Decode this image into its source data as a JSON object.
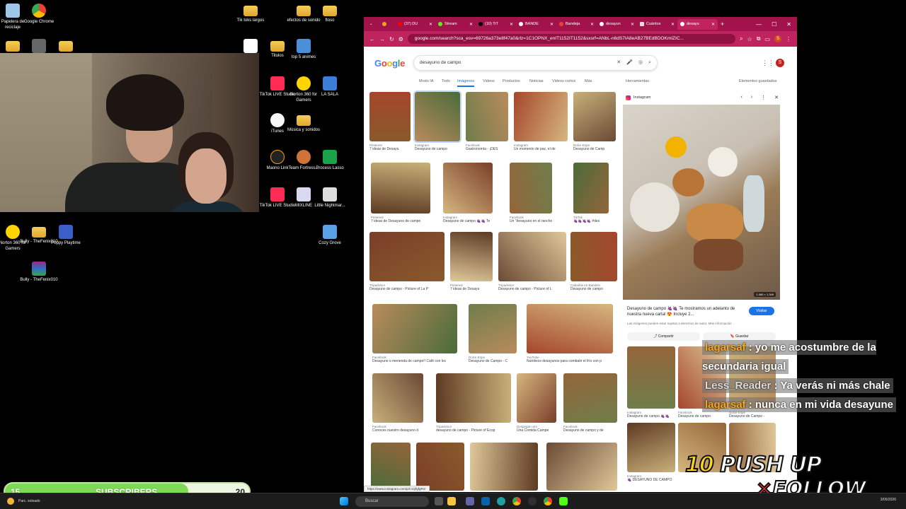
{
  "desktop": {
    "icons": [
      {
        "label": "Papelera de reciclaje",
        "kind": "recycle"
      },
      {
        "label": "Google Chrome",
        "kind": "chrome"
      },
      {
        "label": "Tik toks largos",
        "kind": "folder"
      },
      {
        "label": "efectos de sonido",
        "kind": "folder"
      },
      {
        "label": "ftoso",
        "kind": "folder"
      },
      {
        "label": "Titulos",
        "kind": "folder"
      },
      {
        "label": "top 5 animes",
        "kind": "file"
      },
      {
        "label": "TikTok LIVE Studio",
        "kind": "tiktok"
      },
      {
        "label": "Norton 360 for Gamers",
        "kind": "norton"
      },
      {
        "label": "LA SALA",
        "kind": "file"
      },
      {
        "label": "iTunes",
        "kind": "itunes"
      },
      {
        "label": "Música y sonidos",
        "kind": "folder"
      },
      {
        "label": "Maono Link",
        "kind": "maono"
      },
      {
        "label": "Team Fortress...",
        "kind": "tf"
      },
      {
        "label": "Process Lasso",
        "kind": "lasso"
      },
      {
        "label": "TikTok LIVE Studio",
        "kind": "tiktok"
      },
      {
        "label": "MIXLINE",
        "kind": "mixline"
      },
      {
        "label": "Little Nightmar...",
        "kind": "nightmare"
      },
      {
        "label": "Cozy Grove",
        "kind": "cozy"
      },
      {
        "label": "Norton 360 for Gamers",
        "kind": "norton"
      },
      {
        "label": "Bully - TheFenix010",
        "kind": "folder"
      },
      {
        "label": "Poppy Playtime",
        "kind": "poppy"
      },
      {
        "label": "Bully - TheFenix010",
        "kind": "winrar"
      }
    ]
  },
  "browser": {
    "tabs": [
      {
        "label": "",
        "active": false
      },
      {
        "label": "(37) DU",
        "active": false
      },
      {
        "label": "Stream",
        "active": false
      },
      {
        "label": "(10) TiT",
        "active": false
      },
      {
        "label": "BANDE",
        "active": false
      },
      {
        "label": "Bandeja",
        "active": false
      },
      {
        "label": "desayun",
        "active": false
      },
      {
        "label": "Cuántos",
        "active": false
      },
      {
        "label": "desayu",
        "active": true
      }
    ],
    "url": "google.com/search?sca_esv=69726a373e8f47a0&rlz=1C1OPNX_enIT1152IT1152&sxsrf=ANbL-n6dS7IA8eAB27BEdBDOKmIZIC...",
    "profile_initial": "S"
  },
  "google": {
    "logo": "Google",
    "query": "desayuno de campo",
    "avatar_initial": "S",
    "tabs": [
      "Modo IA",
      "Todo",
      "Imágenes",
      "Videos",
      "Productos",
      "Noticias",
      "Videos cortos",
      "Más",
      "Herramientas"
    ],
    "active_tab": "Imágenes",
    "saved_label": "Elementos guardados",
    "results": [
      {
        "src": "Pinterest",
        "title": "7 ideas de Desayu"
      },
      {
        "src": "Instagram",
        "title": "Desayuno de campo"
      },
      {
        "src": "Facebook",
        "title": "Gastronomía - ¡DES"
      },
      {
        "src": "Instagram",
        "title": "Un momento de paz, el de"
      },
      {
        "src": "Dolce Espe",
        "title": "Desayuno de Camp"
      },
      {
        "src": "Pinterest",
        "title": "7 ideas de Desayuno de campo"
      },
      {
        "src": "Instagram",
        "title": "Desayuno de campo 🍇🍇 Te"
      },
      {
        "src": "Facebook",
        "title": "Un \"desayuno en el rancho"
      },
      {
        "src": "TikTok",
        "title": "🍇🍇🍇🍇 #des"
      },
      {
        "src": "Tripadvisor",
        "title": "Desayuno de campo - Picture of La P"
      },
      {
        "src": "Pinterest",
        "title": "7 ideas de Desayu"
      },
      {
        "src": "Tripadvisor",
        "title": "Desayuno de campo - Picture of L"
      },
      {
        "src": "Cabañas en Bandelo",
        "title": "Desayuno de campo"
      },
      {
        "src": "Facebook",
        "title": "Desayuno o merienda de campo!! Café con lec"
      },
      {
        "src": "Dolce Espe",
        "title": "Desayuno de Campo - C"
      },
      {
        "src": "YouTube",
        "title": "Nutritivos desayunos para combatir el frío con p"
      },
      {
        "src": "Facebook",
        "title": "Conoces nuestro desayuno d"
      },
      {
        "src": "Tripadvisor",
        "title": "desayuno de campo - Picture of Ecop"
      },
      {
        "src": "Despegar.com",
        "title": "Una Comida Campe"
      },
      {
        "src": "Facebook",
        "title": "Desayuno de campo y de"
      },
      {
        "src": "",
        "title": ""
      },
      {
        "src": "",
        "title": ""
      },
      {
        "src": "",
        "title": ""
      },
      {
        "src": "",
        "title": ""
      }
    ],
    "panel": {
      "source": "Instagram",
      "title": "Desayuno de campo 🍇🍇 Te mostramos un adelanto de nuestra nueva carta! 😍 Incluye 2...",
      "visit": "Visitar",
      "note": "Las imágenes pueden estar sujetas a derechos de autor. Más información",
      "share": "Compartir",
      "save": "Guardar",
      "dims": "1.080 × 1.349",
      "related": [
        {
          "src": "Instagram",
          "title": "Desayuno de campo 🍇🍇"
        },
        {
          "src": "Facebook",
          "title": "Desayuno de campo"
        },
        {
          "src": "Dolce Espe",
          "title": "Desayuno de Campo -"
        },
        {
          "src": "Instagram",
          "title": "🍇 DESAYUNO DE CAMPO"
        }
      ]
    },
    "status_url": "https://www.instagram.com/p/C1QfgfgRn/"
  },
  "chat": [
    {
      "user": "lagarsaf",
      "message": "yo me acostumbre de la secundaria igual",
      "user_color": "#f5a623"
    },
    {
      "user": "Less_Reader",
      "message": "Ya verás ni más chale",
      "user_color": "#dddddd"
    },
    {
      "user": "lagarsaf",
      "message": "nunca en mi vida desayune",
      "user_color": "#f5a623"
    }
  ],
  "subscribers": {
    "label": "SUBSCRIBERS",
    "current": "15",
    "goal": "20",
    "progress": 0.75
  },
  "goal_overlay": {
    "count": "10",
    "line1": "PUSH UP",
    "sym": "×",
    "line2": "FOLLOW"
  },
  "taskbar": {
    "weather": "Parc. soleado",
    "search_placeholder": "Buscar",
    "clock": "3/05/2026"
  },
  "colors": {
    "browser_frame": "#a1134a",
    "subs_fill": "#7ed957",
    "chat_user": "#f5a623"
  }
}
